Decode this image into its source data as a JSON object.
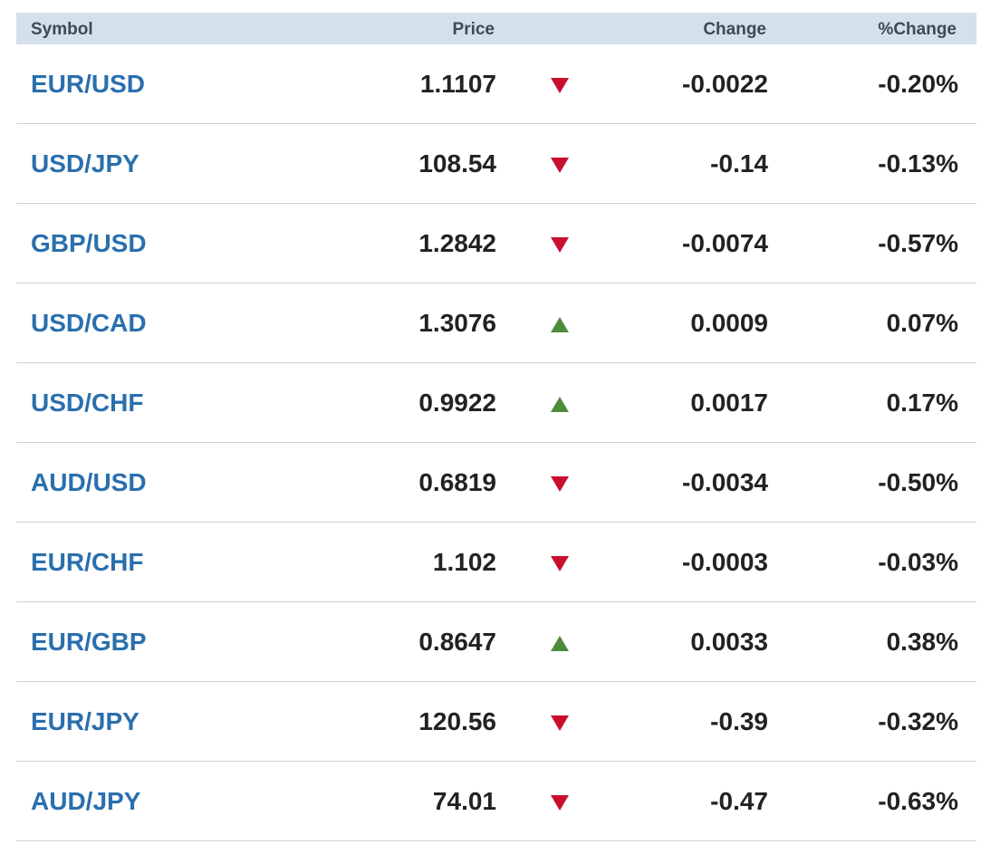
{
  "header": {
    "symbol": "Symbol",
    "price": "Price",
    "change": "Change",
    "pct_change": "%Change"
  },
  "colors": {
    "symbol_link": "#2a6fad",
    "down": "#c8102e",
    "up": "#4c8c3a",
    "header_bg": "#d4e0ea"
  },
  "rows": [
    {
      "symbol": "EUR/USD",
      "price": "1.1107",
      "direction": "down",
      "change": "-0.0022",
      "pct": "-0.20%"
    },
    {
      "symbol": "USD/JPY",
      "price": "108.54",
      "direction": "down",
      "change": "-0.14",
      "pct": "-0.13%"
    },
    {
      "symbol": "GBP/USD",
      "price": "1.2842",
      "direction": "down",
      "change": "-0.0074",
      "pct": "-0.57%"
    },
    {
      "symbol": "USD/CAD",
      "price": "1.3076",
      "direction": "up",
      "change": "0.0009",
      "pct": "0.07%"
    },
    {
      "symbol": "USD/CHF",
      "price": "0.9922",
      "direction": "up",
      "change": "0.0017",
      "pct": "0.17%"
    },
    {
      "symbol": "AUD/USD",
      "price": "0.6819",
      "direction": "down",
      "change": "-0.0034",
      "pct": "-0.50%"
    },
    {
      "symbol": "EUR/CHF",
      "price": "1.102",
      "direction": "down",
      "change": "-0.0003",
      "pct": "-0.03%"
    },
    {
      "symbol": "EUR/GBP",
      "price": "0.8647",
      "direction": "up",
      "change": "0.0033",
      "pct": "0.38%"
    },
    {
      "symbol": "EUR/JPY",
      "price": "120.56",
      "direction": "down",
      "change": "-0.39",
      "pct": "-0.32%"
    },
    {
      "symbol": "AUD/JPY",
      "price": "74.01",
      "direction": "down",
      "change": "-0.47",
      "pct": "-0.63%"
    }
  ]
}
